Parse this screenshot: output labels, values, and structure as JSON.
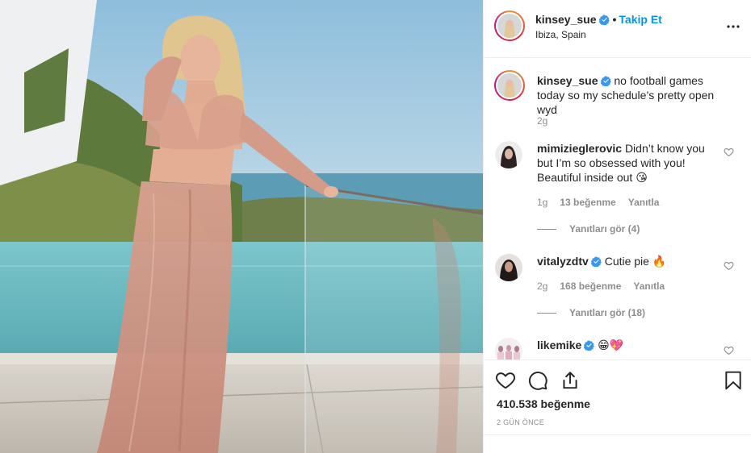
{
  "post": {
    "username": "kinsey_sue",
    "separator": "•",
    "follow_label": "Takip Et",
    "location": "Ibiza, Spain",
    "caption": {
      "username": "kinsey_sue",
      "text": "no football games today so my schedule’s pretty open wyd",
      "time": "2g"
    },
    "comments": [
      {
        "username": "mimizieglerovic",
        "text": "Didn’t know you but I’m so obsessed with you! Beautiful inside out 😘",
        "time": "1g",
        "likes": "13 beğenme",
        "reply_label": "Yanıtla",
        "view_replies": "Yanıtları gör (4)"
      },
      {
        "username": "vitalyzdtv",
        "text": "Cutie pie 🔥",
        "time": "2g",
        "likes": "168 beğenme",
        "reply_label": "Yanıtla",
        "view_replies": "Yanıtları gör (18)"
      },
      {
        "username": "likemike",
        "text": "😁💖"
      }
    ],
    "like_count": "410.538 beğenme",
    "posted_ago": "2 GÜN ÖNCE"
  },
  "icons": {
    "verified": "verified-badge-icon",
    "more": "more-options-icon",
    "like": "heart-icon",
    "comment": "comment-icon",
    "share": "share-icon",
    "save": "bookmark-icon"
  },
  "colors": {
    "accent": "#0095f6",
    "muted": "#8e8e8e",
    "text": "#262626"
  }
}
